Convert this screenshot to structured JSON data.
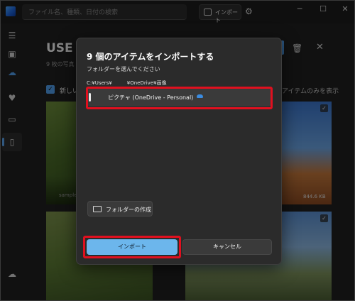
{
  "titlebar": {
    "search_placeholder": "ファイル名、種類、日付の検索",
    "import_label": "インポート",
    "settings_icon": "gear-icon",
    "minimize_glyph": "─",
    "maximize_glyph": "☐",
    "close_glyph": "✕"
  },
  "background": {
    "title": "USE",
    "subtitle": "9 枚の写真",
    "new_label": "新しい",
    "right_text": "アイテムのみを表示",
    "tiles": [
      {
        "label": "sample"
      },
      {
        "label": "844.6 KB"
      }
    ]
  },
  "dialog": {
    "title": "9 個のアイテムをインポートする",
    "subtitle": "フォルダーを選んでください",
    "path": "C:¥Users¥　　　¥OneDrive¥画像",
    "folder_item": "ピクチャ (OneDrive - Personal)",
    "create_folder_label": "フォルダーの作成",
    "import_button": "インポート",
    "cancel_button": "キャンセル"
  },
  "colors": {
    "accent": "#6cb6ec",
    "highlight_red": "#e0101f",
    "dialog_bg": "#2b2b2b"
  }
}
